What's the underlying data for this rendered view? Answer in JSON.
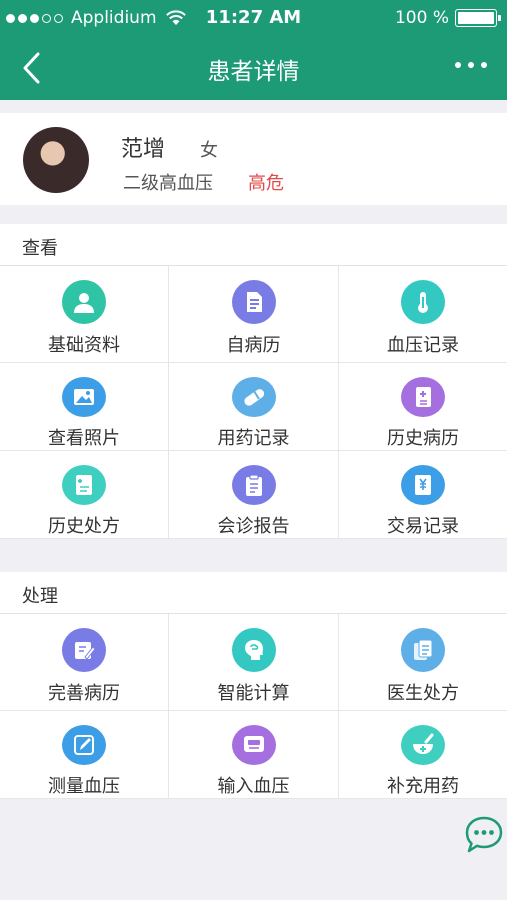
{
  "status_bar": {
    "carrier": "Applidium",
    "time": "11:27 AM",
    "battery": "100 %"
  },
  "navbar": {
    "title": "患者详情",
    "back_icon": "chevron-left-icon",
    "more_icon": "more-dots-icon"
  },
  "patient": {
    "name": "范增",
    "gender": "女",
    "diagnosis": "二级高血压",
    "risk": "高危"
  },
  "view_section": {
    "title": "查看",
    "items": [
      {
        "label": "基础资料",
        "icon": "person-icon",
        "color": "#2fc4a5"
      },
      {
        "label": "自病历",
        "icon": "document-icon",
        "color": "#7a7ce6"
      },
      {
        "label": "血压记录",
        "icon": "thermometer-icon",
        "color": "#34c8c3"
      },
      {
        "label": "查看照片",
        "icon": "image-icon",
        "color": "#3b9ee6"
      },
      {
        "label": "用药记录",
        "icon": "pill-icon",
        "color": "#5eaee8"
      },
      {
        "label": "历史病历",
        "icon": "medical-book-icon",
        "color": "#a56fe0"
      },
      {
        "label": "历史处方",
        "icon": "prescription-icon",
        "color": "#3fcfc0"
      },
      {
        "label": "会诊报告",
        "icon": "clipboard-icon",
        "color": "#7a7ce6"
      },
      {
        "label": "交易记录",
        "icon": "yuan-book-icon",
        "color": "#3b9ee6"
      }
    ]
  },
  "process_section": {
    "title": "处理",
    "items": [
      {
        "label": "完善病历",
        "icon": "edit-note-icon",
        "color": "#7a7ce6"
      },
      {
        "label": "智能计算",
        "icon": "brain-head-icon",
        "color": "#34c8c3"
      },
      {
        "label": "医生处方",
        "icon": "files-icon",
        "color": "#5eaee8"
      },
      {
        "label": "测量血压",
        "icon": "pencil-icon",
        "color": "#3b9ee6"
      },
      {
        "label": "输入血压",
        "icon": "monitor-icon",
        "color": "#a56fe0"
      },
      {
        "label": "补充用药",
        "icon": "mortar-icon",
        "color": "#3fcfc0"
      }
    ]
  },
  "chat_icon": "chat-bubble-icon",
  "colors": {
    "header_bg": "#1d9b76",
    "risk": "#e24a4a",
    "page_bg": "#efeff4"
  }
}
